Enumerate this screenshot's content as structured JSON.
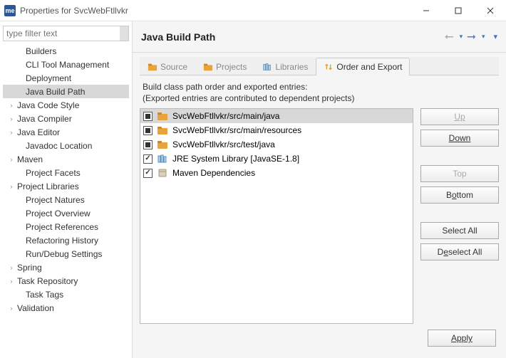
{
  "window": {
    "app_icon_text": "me",
    "title": "Properties for SvcWebFtllvkr"
  },
  "filter": {
    "placeholder": "type filter text"
  },
  "tree": [
    {
      "label": "Builders",
      "expandable": false,
      "indent": 1
    },
    {
      "label": "CLI Tool Management",
      "expandable": false,
      "indent": 1
    },
    {
      "label": "Deployment",
      "expandable": false,
      "indent": 1
    },
    {
      "label": "Java Build Path",
      "expandable": false,
      "indent": 1,
      "selected": true
    },
    {
      "label": "Java Code Style",
      "expandable": true,
      "indent": 0
    },
    {
      "label": "Java Compiler",
      "expandable": true,
      "indent": 0
    },
    {
      "label": "Java Editor",
      "expandable": true,
      "indent": 0
    },
    {
      "label": "Javadoc Location",
      "expandable": false,
      "indent": 1
    },
    {
      "label": "Maven",
      "expandable": true,
      "indent": 0
    },
    {
      "label": "Project Facets",
      "expandable": false,
      "indent": 1
    },
    {
      "label": "Project Libraries",
      "expandable": true,
      "indent": 0
    },
    {
      "label": "Project Natures",
      "expandable": false,
      "indent": 1
    },
    {
      "label": "Project Overview",
      "expandable": false,
      "indent": 1
    },
    {
      "label": "Project References",
      "expandable": false,
      "indent": 1
    },
    {
      "label": "Refactoring History",
      "expandable": false,
      "indent": 1
    },
    {
      "label": "Run/Debug Settings",
      "expandable": false,
      "indent": 1
    },
    {
      "label": "Spring",
      "expandable": true,
      "indent": 0
    },
    {
      "label": "Task Repository",
      "expandable": true,
      "indent": 0
    },
    {
      "label": "Task Tags",
      "expandable": false,
      "indent": 1
    },
    {
      "label": "Validation",
      "expandable": true,
      "indent": 0
    }
  ],
  "page": {
    "heading": "Java Build Path",
    "tabs": [
      {
        "label": "Source",
        "icon": "folder"
      },
      {
        "label": "Projects",
        "icon": "folder"
      },
      {
        "label": "Libraries",
        "icon": "library"
      },
      {
        "label": "Order and Export",
        "icon": "order",
        "active": true
      }
    ],
    "desc_line1": "Build class path order and exported entries:",
    "desc_line2": "(Exported entries are contributed to dependent projects)",
    "entries": [
      {
        "label": "SvcWebFtllvkr/src/main/java",
        "check": "filled",
        "icon": "pkgfolder",
        "selected": true
      },
      {
        "label": "SvcWebFtllvkr/src/main/resources",
        "check": "filled",
        "icon": "pkgfolder"
      },
      {
        "label": "SvcWebFtllvkr/src/test/java",
        "check": "filled",
        "icon": "pkgfolder"
      },
      {
        "label": "JRE System Library [JavaSE-1.8]",
        "check": "checked",
        "icon": "library"
      },
      {
        "label": "Maven Dependencies",
        "check": "checked",
        "icon": "jar"
      }
    ],
    "buttons": {
      "up": "Up",
      "down": "Down",
      "top": "Top",
      "bottom": "Bottom",
      "select_all": "Select All",
      "deselect_all": "Deselect All",
      "apply": "Apply"
    }
  }
}
